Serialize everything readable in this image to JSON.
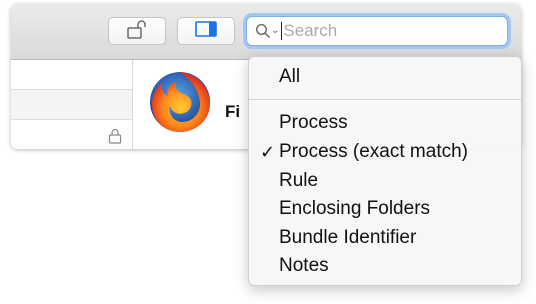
{
  "toolbar": {
    "lock_button_icon": "unlocked-padlock-icon",
    "sidebar_button_icon": "sidebar-toggle-icon",
    "search": {
      "placeholder": "Search",
      "value": "",
      "icon": "search-icon",
      "menu_chevron": "chevron-down-icon"
    }
  },
  "main": {
    "row_icon": "lock-icon",
    "app_icon": "firefox-logo",
    "app_name": "Fi"
  },
  "search_menu": {
    "items": [
      {
        "label": "All",
        "checked": false
      },
      {
        "label": "Process",
        "checked": false
      },
      {
        "label": "Process (exact match)",
        "checked": true
      },
      {
        "label": "Rule",
        "checked": false
      },
      {
        "label": "Enclosing Folders",
        "checked": false
      },
      {
        "label": "Bundle Identifier",
        "checked": false
      },
      {
        "label": "Notes",
        "checked": false
      }
    ],
    "check_mark": "✓"
  },
  "colors": {
    "accent": "#1a73e8",
    "focus_ring": "#a5c8f2"
  }
}
